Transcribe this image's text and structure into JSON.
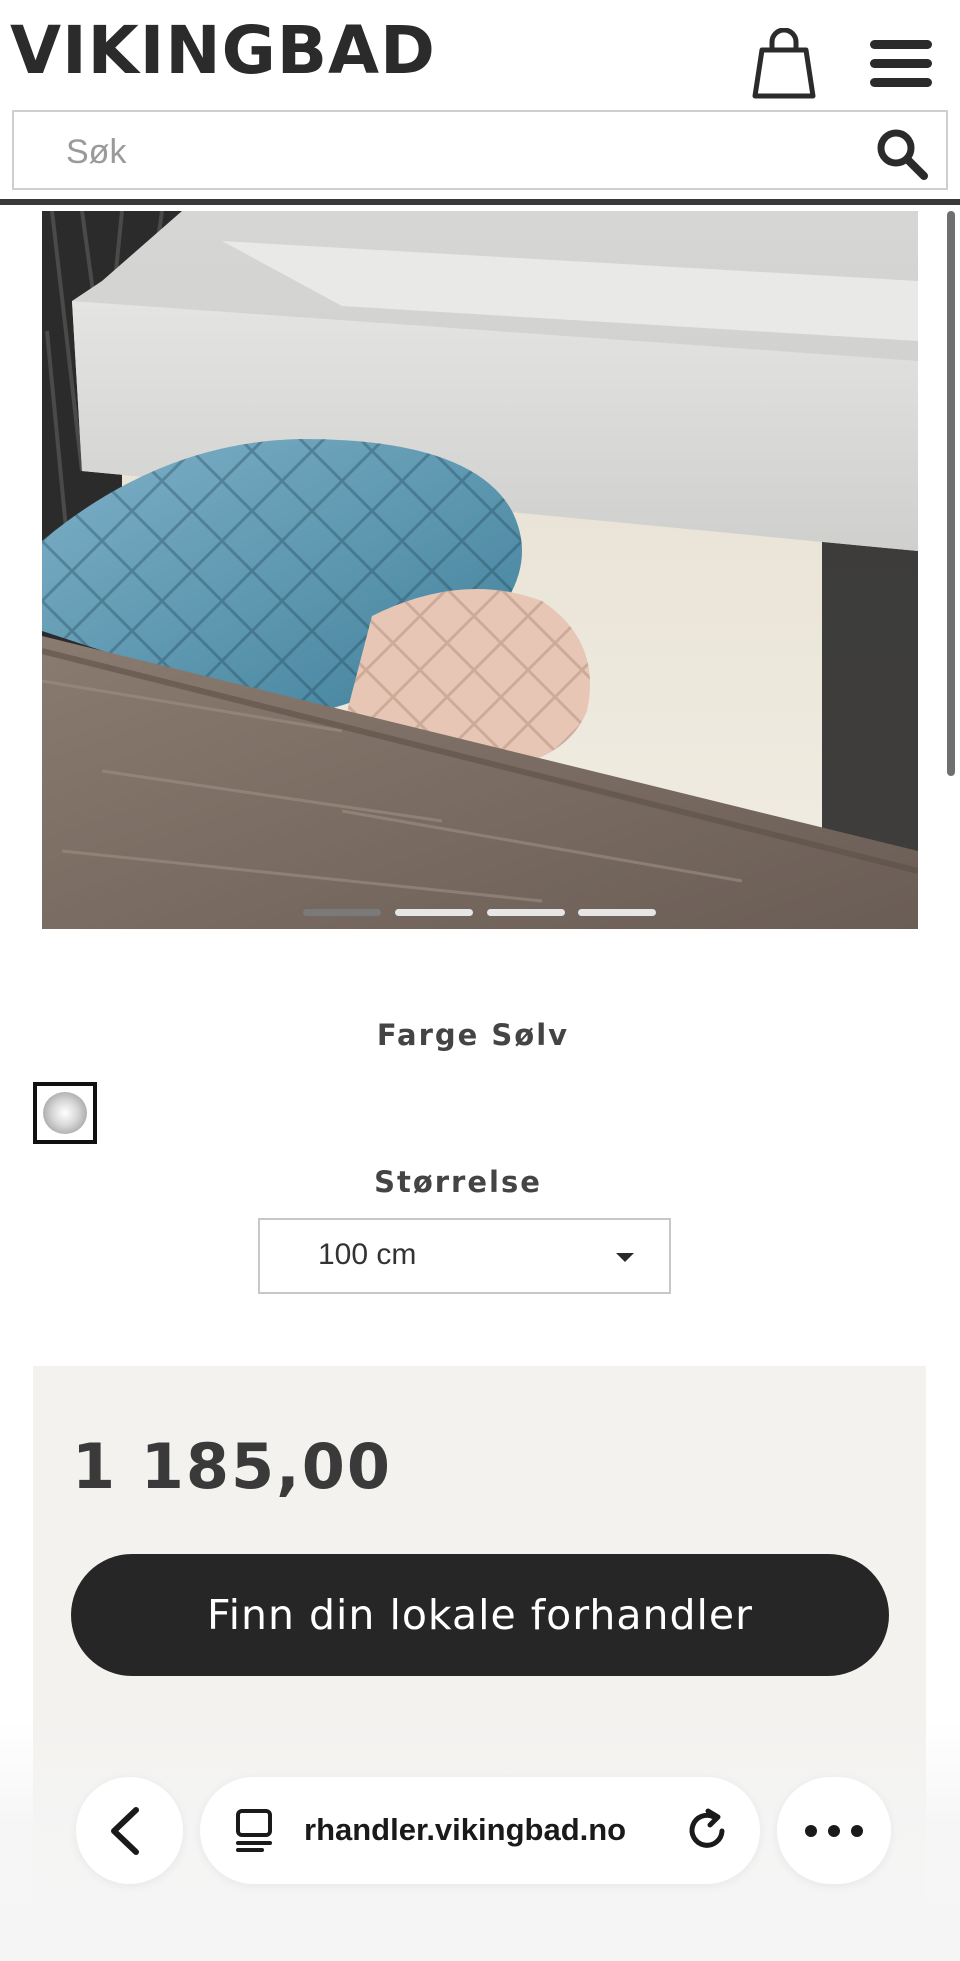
{
  "header": {
    "logo_text": "VIKINGBAD",
    "cart_icon": "shopping-bag-icon",
    "menu_icon": "hamburger-menu-icon"
  },
  "search": {
    "placeholder": "Søk",
    "value": "",
    "icon": "search-icon"
  },
  "gallery": {
    "image_description_icon": "product-photo",
    "slide_count": 4,
    "active_slide": 1
  },
  "options": {
    "color_label": "Farge Sølv",
    "color_swatch": "silver",
    "size_label": "Størrelse",
    "size_selected": "100 cm"
  },
  "purchase": {
    "price": "1 185,00",
    "cta_label": "Finn din lokale forhandler"
  },
  "browser": {
    "url": "rhandler.vikingbad.no",
    "back_icon": "chevron-left-icon",
    "tab_icon": "tabs-icon",
    "reload_icon": "reload-icon",
    "more_icon": "more-icon"
  },
  "colors": {
    "text_dark": "#2b2b2b",
    "button_dark": "#262626",
    "panel_bg": "#f3f2ef",
    "swatch_border": "#111111"
  }
}
